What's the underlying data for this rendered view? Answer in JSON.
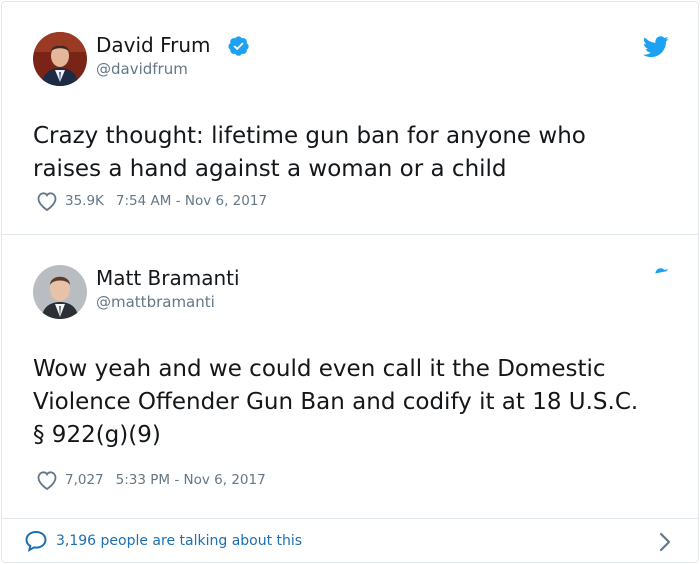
{
  "tweets": [
    {
      "name": "David Frum",
      "handle": "@davidfrum",
      "verified": true,
      "text_lines": [
        "Crazy thought: lifetime gun ban for anyone who",
        "raises a hand against a woman or a child"
      ],
      "likes": "35.9K",
      "timestamp": "7:54 AM - Nov 6, 2017"
    },
    {
      "name": "Matt Bramanti",
      "handle": "@mattbramanti",
      "verified": false,
      "text_lines": [
        "Wow yeah and we could even call it the Domestic",
        "Violence Offender Gun Ban and codify it at 18 U.S.C.",
        "§ 922(g)(9)"
      ],
      "likes": "7,027",
      "timestamp": "5:33 PM - Nov 6, 2017"
    }
  ],
  "footer": {
    "talking_text": "3,196 people are talking about this"
  },
  "colors": {
    "twitter_blue": "#1da1f2",
    "link_blue": "#1b6fb3",
    "meta_gray": "#657786",
    "border": "#e1e8ed"
  },
  "icons": [
    "twitter-bird-icon",
    "verified-badge-icon",
    "heart-icon",
    "speech-bubble-icon",
    "chevron-right-icon"
  ]
}
